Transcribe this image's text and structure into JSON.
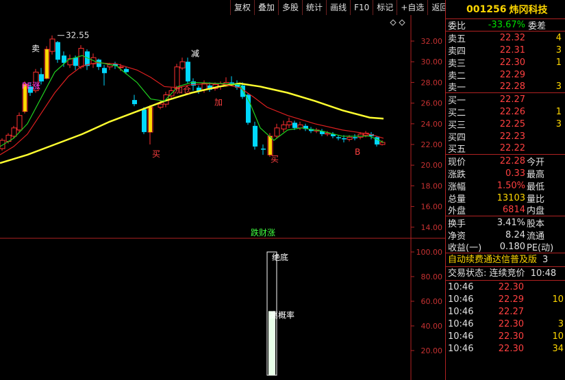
{
  "toolbar": [
    "复权",
    "叠加",
    "多股",
    "统计",
    "画线",
    "F10",
    "标记",
    "+自选",
    "返回"
  ],
  "stock": {
    "code": "001256",
    "name": "炜冈科技"
  },
  "weibi": {
    "label": "委比",
    "value": "-33.67%",
    "label2": "委差"
  },
  "sell": [
    {
      "label": "卖五",
      "price": "22.32",
      "vol": "4"
    },
    {
      "label": "卖四",
      "price": "22.31",
      "vol": "3"
    },
    {
      "label": "卖三",
      "price": "22.30",
      "vol": "1"
    },
    {
      "label": "卖二",
      "price": "22.29",
      "vol": ""
    },
    {
      "label": "卖一",
      "price": "22.28",
      "vol": "3"
    }
  ],
  "buy": [
    {
      "label": "买一",
      "price": "22.27",
      "vol": ""
    },
    {
      "label": "买二",
      "price": "22.26",
      "vol": "1"
    },
    {
      "label": "买三",
      "price": "22.25",
      "vol": "3"
    },
    {
      "label": "买四",
      "price": "22.23",
      "vol": ""
    },
    {
      "label": "买五",
      "price": "22.22",
      "vol": ""
    }
  ],
  "stats": [
    {
      "l1": "现价",
      "v1": "22.28",
      "l2": "今开",
      "c1": "red"
    },
    {
      "l1": "涨跌",
      "v1": "0.33",
      "l2": "最高",
      "c1": "red"
    },
    {
      "l1": "涨幅",
      "v1": "1.50%",
      "l2": "最低",
      "c1": "red"
    },
    {
      "l1": "总量",
      "v1": "13103",
      "l2": "量比",
      "c1": "yellow"
    },
    {
      "l1": "外盘",
      "v1": "6814",
      "l2": "内盘",
      "c1": "red"
    }
  ],
  "stats2": [
    {
      "l1": "换手",
      "v1": "3.41%",
      "l2": "股本"
    },
    {
      "l1": "净资",
      "v1": "8.24",
      "l2": "流通"
    },
    {
      "l1": "收益(一)",
      "v1": "0.180",
      "l2": "PE(动)"
    }
  ],
  "marquee": "自动续费通达信普及版",
  "marquee_tail": "3",
  "status": {
    "label": "交易状态:",
    "value": "连续竞价",
    "time": "10:48"
  },
  "ticks": [
    {
      "time": "10:46",
      "price": "22.30",
      "vol": ""
    },
    {
      "time": "10:46",
      "price": "22.29",
      "vol": "10"
    },
    {
      "time": "10:46",
      "price": "22.27",
      "vol": ""
    },
    {
      "time": "10:46",
      "price": "22.30",
      "vol": "3"
    },
    {
      "time": "10:46",
      "price": "22.30",
      "vol": "10"
    },
    {
      "time": "10:46",
      "price": "22.30",
      "vol": "34"
    }
  ],
  "kline": {
    "y_ticks": [
      "32.00",
      "30.00",
      "28.00",
      "26.00",
      "24.00",
      "22.00",
      "20.00",
      "18.00",
      "16.00",
      "14.00"
    ],
    "high_label": "32.55",
    "center_label": "跌财涨",
    "marks": [
      {
        "text": "卖",
        "color": "#ffffff"
      },
      {
        "text": "减",
        "color": "#ffffff"
      },
      {
        "text": "加仓",
        "color": "#ff4040"
      },
      {
        "text": "加",
        "color": "#ff4040"
      },
      {
        "text": "买",
        "color": "#ff4040"
      },
      {
        "text": "买",
        "color": "#ff4040"
      },
      {
        "text": "B",
        "color": "#ff4040"
      },
      {
        "text": "PE涨",
        "color": "#ff40ff"
      }
    ]
  },
  "indicator": {
    "y_ticks": [
      "100.00",
      "80.00",
      "60.00",
      "40.00",
      "20.00"
    ],
    "label1": "绝底",
    "label2": "高概率",
    "bar_value": 100,
    "bar2_value": 52
  }
}
